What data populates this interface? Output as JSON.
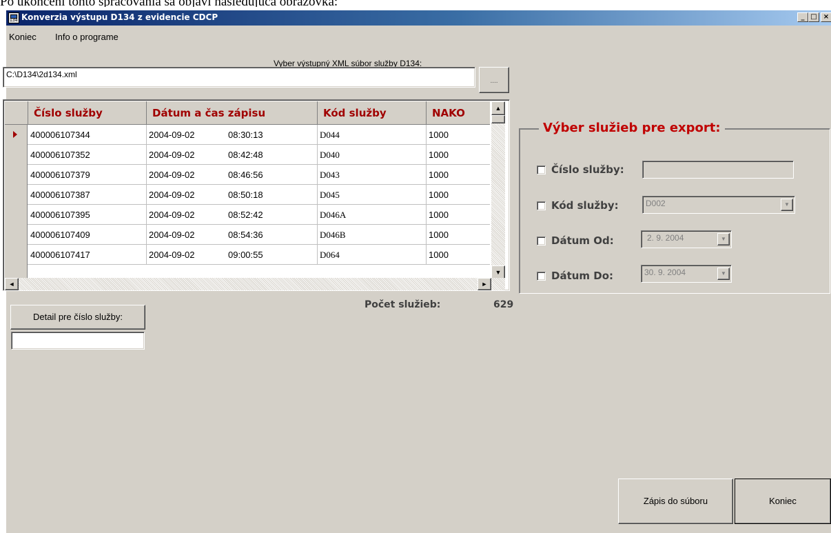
{
  "caption": "Po ukončení tohto spracovania sa objaví nasledujúca obrazovka:",
  "window": {
    "title": "Konverzia výstupu D134 z evidencie CDCP",
    "icon_label": "134",
    "minimize": "_",
    "maximize": "□",
    "close": "×"
  },
  "menu": [
    "Koniec",
    "Info o programe"
  ],
  "file_select": {
    "label": "Vyber výstupný XML súbor služby D134:",
    "value": "C:\\D134\\2d134.xml",
    "browse_label": "...."
  },
  "grid": {
    "columns": [
      "Číslo služby",
      "Dátum a čas zápisu",
      "Kód služby",
      "NAKO"
    ],
    "rows": [
      {
        "cislo": "400006107344",
        "datum": "2004-09-02",
        "cas": "08:30:13",
        "kod": "D044",
        "nako": "1000"
      },
      {
        "cislo": "400006107352",
        "datum": "2004-09-02",
        "cas": "08:42:48",
        "kod": "D040",
        "nako": "1000"
      },
      {
        "cislo": "400006107379",
        "datum": "2004-09-02",
        "cas": "08:46:56",
        "kod": "D043",
        "nako": "1000"
      },
      {
        "cislo": "400006107387",
        "datum": "2004-09-02",
        "cas": "08:50:18",
        "kod": "D045",
        "nako": "1000"
      },
      {
        "cislo": "400006107395",
        "datum": "2004-09-02",
        "cas": "08:52:42",
        "kod": "D046A",
        "nako": "1000"
      },
      {
        "cislo": "400006107409",
        "datum": "2004-09-02",
        "cas": "08:54:36",
        "kod": "D046B",
        "nako": "1000"
      },
      {
        "cislo": "400006107417",
        "datum": "2004-09-02",
        "cas": "09:00:55",
        "kod": "D064",
        "nako": "1000"
      }
    ],
    "scroll_up": "▲",
    "scroll_down": "▼",
    "scroll_left": "◄",
    "scroll_right": "►"
  },
  "count": {
    "label": "Počet služieb:",
    "value": "629"
  },
  "detail": {
    "button_label": "Detail pre číslo služby:",
    "value": ""
  },
  "export": {
    "title": "Výber služieb pre export:",
    "cislo_label": "Číslo služby:",
    "cislo_value": "",
    "kod_label": "Kód služby:",
    "kod_value": "D002",
    "od_label": "Dátum Od:",
    "od_value": "2. 9. 2004",
    "do_label": "Dátum Do:",
    "do_value": "30. 9. 2004"
  },
  "buttons": {
    "save": "Zápis do súboru",
    "exit": "Koniec"
  }
}
